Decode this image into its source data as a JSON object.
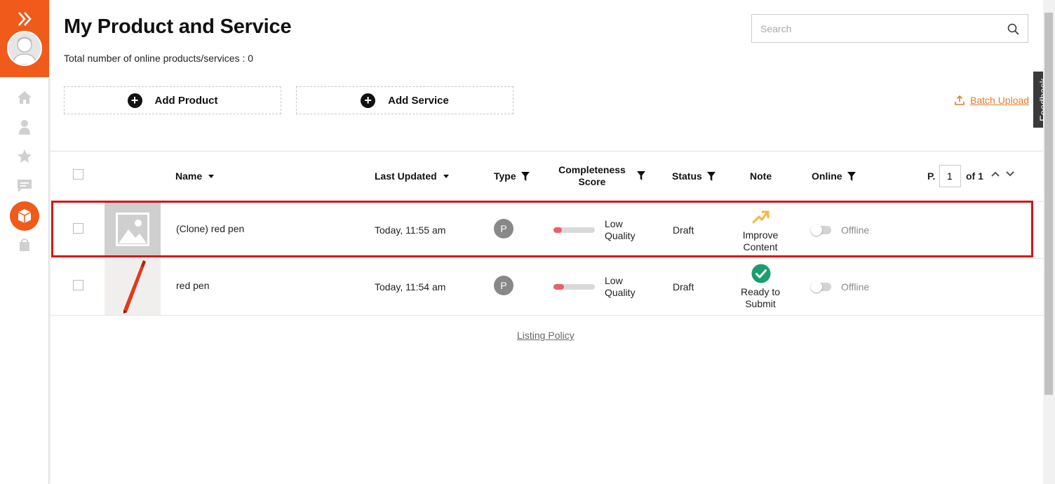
{
  "header": {
    "title": "My Product and Service",
    "total_line": "Total number of online products/services : 0"
  },
  "search": {
    "placeholder": "Search",
    "value": ""
  },
  "actions": {
    "add_product": "Add Product",
    "add_service": "Add Service",
    "batch_upload": "Batch Upload"
  },
  "feedback": "Feedback",
  "table": {
    "columns": {
      "name": "Name",
      "last_updated": "Last Updated",
      "type": "Type",
      "completeness_1": "Completeness",
      "completeness_2": "Score",
      "status": "Status",
      "note": "Note",
      "online": "Online"
    },
    "pager": {
      "label": "P.",
      "current": "1",
      "of": "of 1"
    },
    "rows": [
      {
        "name": "(Clone) red pen",
        "last_updated": "Today, 11:55 am",
        "type": "P",
        "score_1": "Low",
        "score_2": "Quality",
        "score_fraction": 0.2,
        "status": "Draft",
        "note_1": "Improve",
        "note_2": "Content",
        "note_icon": "trending-up-icon",
        "online_label": "Offline",
        "online": false
      },
      {
        "name": "red pen",
        "last_updated": "Today, 11:54 am",
        "type": "P",
        "score_1": "Low",
        "score_2": "Quality",
        "score_fraction": 0.25,
        "status": "Draft",
        "note_1": "Ready to",
        "note_2": "Submit",
        "note_icon": "check-circle-icon",
        "online_label": "Offline",
        "online": false
      }
    ]
  },
  "footer": {
    "listing_policy": "Listing Policy"
  },
  "colors": {
    "brand": "#f05a1a",
    "link": "#e8782a",
    "score_low": "#e9606a",
    "ready_green": "#1a9e6e",
    "improve_orange": "#f5b53f",
    "highlight_red": "#e01010"
  }
}
